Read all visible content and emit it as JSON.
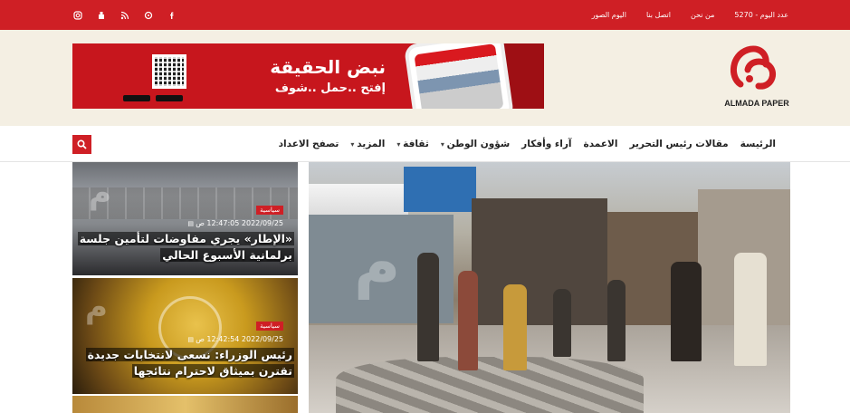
{
  "topbar": {
    "links": [
      "عدد اليوم - 5270",
      "من نحن",
      "اتصل بنا",
      "اليوم الصور"
    ],
    "social_icons": [
      "instagram-icon",
      "youtube-icon",
      "rss-icon",
      "soundcloud-icon",
      "facebook-icon"
    ]
  },
  "banner": {
    "headline": "نبض الحقيقة",
    "subline": "إفتح ..حمل ..شوف"
  },
  "logo": {
    "text": "ALMADA PAPER"
  },
  "nav": {
    "items": [
      {
        "label": "الرئيسة",
        "dropdown": false
      },
      {
        "label": "مقالات رئيس التحرير",
        "dropdown": false
      },
      {
        "label": "الاعمدة",
        "dropdown": false
      },
      {
        "label": "آراء وأفكار",
        "dropdown": false
      },
      {
        "label": "شؤون الوطن",
        "dropdown": true
      },
      {
        "label": "ثقافة",
        "dropdown": true
      },
      {
        "label": "المزيد",
        "dropdown": true
      },
      {
        "label": "تصفح الاعداد",
        "dropdown": false
      }
    ]
  },
  "articles": [
    {
      "category": "سياسية",
      "date": "2022/09/25 12:47:05 ص",
      "title": "«الإطار» يجري مفاوضات لتأمين جلسة برلمانية الأسبوع الحالي"
    },
    {
      "category": "سياسية",
      "date": "2022/09/25 12:42:54 ص",
      "title": "رئيس الوزراء: نسعى لانتخابات جديدة تقترن بميثاق لاحترام نتائجها"
    }
  ],
  "colors": {
    "brand_red": "#cf1f25",
    "header_bg": "#f4efe3"
  }
}
